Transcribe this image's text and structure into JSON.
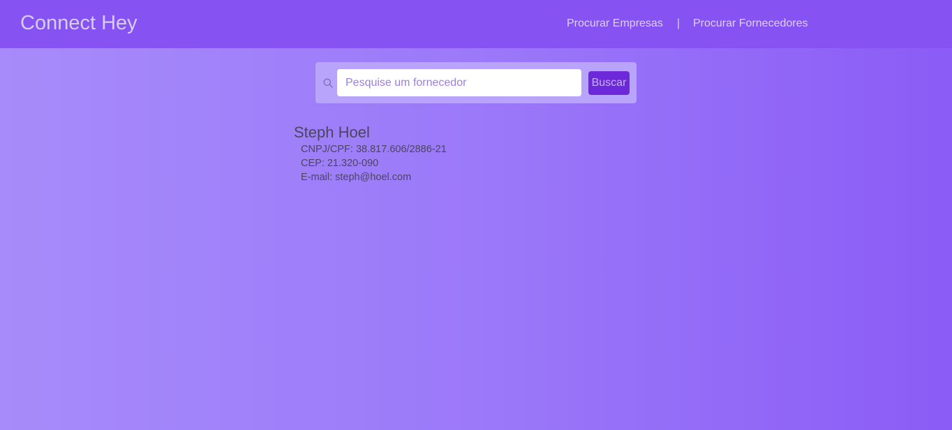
{
  "header": {
    "brand": "Connect Hey",
    "nav": {
      "companies": "Procurar Empresas",
      "separator": "|",
      "suppliers": "Procurar Fornecedores"
    }
  },
  "search": {
    "icon": "search-icon",
    "placeholder": "Pesquise um fornecedor",
    "value": "",
    "button_label": "Buscar"
  },
  "results": [
    {
      "name": "Steph Hoel",
      "cnpj_cpf": "CNPJ/CPF: 38.817.606/2886-21",
      "cep": "CEP: 21.320-090",
      "email": "E-mail: steph@hoel.com"
    }
  ],
  "colors": {
    "header_bg": "#8652f1",
    "page_gradient_start": "#a78bfa",
    "page_gradient_end": "#8b5cf6",
    "button_bg": "#6d28d9",
    "search_panel_bg": "#b9a4fb"
  }
}
